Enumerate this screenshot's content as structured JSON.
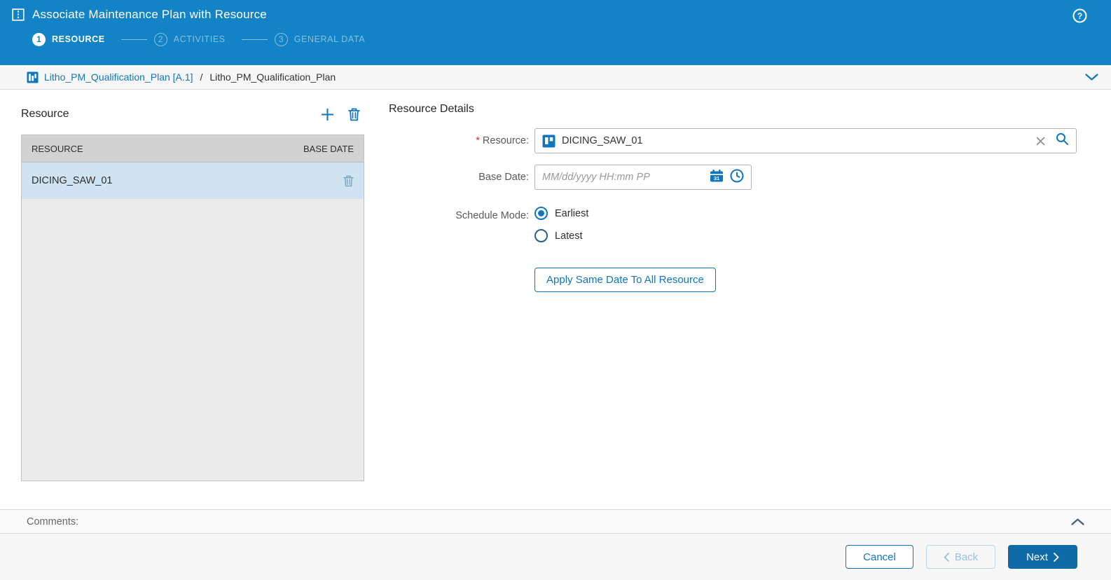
{
  "header": {
    "title": "Associate Maintenance Plan with Resource",
    "help_glyph": "?",
    "steps": [
      {
        "number": "1",
        "label": "RESOURCE",
        "state": "active"
      },
      {
        "number": "2",
        "label": "ACTIVITIES",
        "state": "inactive"
      },
      {
        "number": "3",
        "label": "GENERAL DATA",
        "state": "inactive"
      }
    ]
  },
  "breadcrumb": {
    "link": "Litho_PM_Qualification_Plan [A.1]",
    "separator": "/",
    "current": "Litho_PM_Qualification_Plan"
  },
  "resource_panel": {
    "title": "Resource",
    "columns": {
      "resource": "RESOURCE",
      "base_date": "BASE DATE"
    },
    "rows": [
      {
        "resource": "DICING_SAW_01",
        "base_date": "",
        "selected": true
      }
    ]
  },
  "details_panel": {
    "title": "Resource Details",
    "resource_field": {
      "required_mark": "*",
      "label": "Resource:",
      "value": "DICING_SAW_01"
    },
    "base_date_field": {
      "label": "Base Date:",
      "value": "",
      "placeholder": "MM/dd/yyyy HH:mm PP"
    },
    "schedule_mode": {
      "label": "Schedule Mode:",
      "options": [
        {
          "label": "Earliest",
          "selected": true
        },
        {
          "label": "Latest",
          "selected": false
        }
      ]
    },
    "apply_button_label": "Apply Same Date To All Resource"
  },
  "comments": {
    "label": "Comments:"
  },
  "footer": {
    "cancel_label": "Cancel",
    "back_label": "Back",
    "next_label": "Next"
  },
  "colors": {
    "header_blue": "#1283c6",
    "accent_blue": "#1076bc",
    "primary_button_blue": "#0e6ba8",
    "selected_row_blue": "#cfe3f2",
    "table_header_gray": "#d2d2d2",
    "required_red": "#c0392b"
  }
}
